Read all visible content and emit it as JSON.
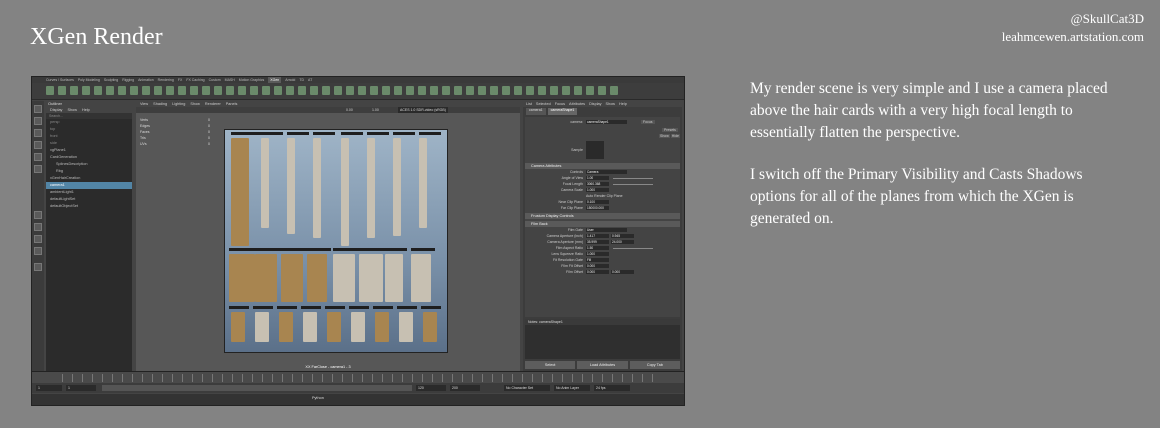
{
  "slide": {
    "title": "XGen Render",
    "handle": "@SkullCat3D",
    "site": "leahmcewen.artstation.com",
    "paragraphs": [
      "My render scene is very simple and I use a camera placed above the hair cards with a very high focal length to essentially flatten the perspective.",
      "I switch off the Primary Visibility and Casts Shadows options for all of the planes from which the XGen is generated on."
    ]
  },
  "maya": {
    "menu": [
      "Curves / Surfaces",
      "Poly Modeling",
      "Sculpting",
      "Rigging",
      "Animation",
      "Rendering",
      "FX",
      "FX Caching",
      "Custom",
      "MASH",
      "Motion Graphics",
      "XGen",
      "Arnold",
      "TD",
      "AT"
    ],
    "active_menu": "XGen",
    "outliner": {
      "title": "Outliner",
      "menu": [
        "Display",
        "Show",
        "Help"
      ],
      "search_placeholder": "Search...",
      "items": [
        "persp",
        "top",
        "front",
        "side",
        "xgPlane1",
        "CardGeneration",
        "SplinesDescription",
        "Rbg",
        "xGenHairCreation",
        "camera1",
        "ambientLight1",
        "defaultLightSet",
        "defaultObjectSet"
      ],
      "selected": "camera1"
    },
    "viewport": {
      "menu": [
        "View",
        "Shading",
        "Lighting",
        "Show",
        "Renderer",
        "Panels"
      ],
      "hud": [
        [
          "Verts",
          "",
          "0"
        ],
        [
          "Edges",
          "",
          "0"
        ],
        [
          "Faces",
          "",
          "0"
        ],
        [
          "Tris",
          "",
          "0"
        ],
        [
          "UVs",
          "",
          "0"
        ]
      ],
      "color_space": "ACES 1.0 SDR-video (sRGB)",
      "values": [
        "0.00",
        "1.00"
      ],
      "camera_label": "XX FarClose - camera1 - 3"
    },
    "attribute_editor": {
      "menu": [
        "List",
        "Selected",
        "Focus",
        "Attributes",
        "Display",
        "Show",
        "Help"
      ],
      "tabs": [
        "camera1",
        "cameraShape1"
      ],
      "active_tab": "cameraShape1",
      "camera_label": "camera:",
      "camera_value": "cameraShape1",
      "buttons_side": [
        "Focus",
        "Presets",
        "Show",
        "Hide"
      ],
      "sample_label": "Sample",
      "sections": [
        "Camera Attributes",
        "Frustum Display Controls",
        "Film Back"
      ],
      "camera_attrs": [
        [
          "Controls",
          "Camera"
        ],
        [
          "Angle of View",
          "1.00"
        ],
        [
          "Focal Length",
          "3060.368"
        ],
        [
          "Camera Scale",
          "1.000"
        ],
        [
          "",
          "Auto Render Clip Plane"
        ],
        [
          "Near Clip Plane",
          "0.100"
        ],
        [
          "Far Clip Plane",
          "150000.000"
        ]
      ],
      "film_attrs": [
        [
          "Film Gate",
          "User"
        ],
        [
          "Camera Aperture (inch)",
          "1.417",
          "0.945"
        ],
        [
          "Camera Aperture (mm)",
          "35.999",
          "24.000"
        ],
        [
          "Film Aspect Ratio",
          "1.50"
        ],
        [
          "Lens Squeeze Ratio",
          "1.000"
        ],
        [
          "Fit Resolution Gate",
          "Fill"
        ],
        [
          "Film Fit Offset",
          "0.000"
        ],
        [
          "Film Offset",
          "0.000",
          "0.000"
        ]
      ],
      "notes_label": "Notes:  cameraShape1",
      "bottom_buttons": [
        "Select",
        "Load Attributes",
        "Copy Tab"
      ]
    },
    "range": {
      "start": "1",
      "end": "120",
      "end2": "200",
      "character_set": "No Character Set",
      "anim_layer": "No Anim Layer",
      "fps": "24 fps"
    },
    "command_label": "Python"
  }
}
